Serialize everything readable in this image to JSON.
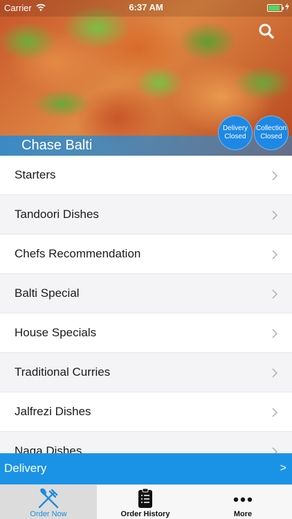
{
  "status_bar": {
    "carrier": "Carrier",
    "time": "6:37 AM",
    "battery_level": 0.9
  },
  "hero": {
    "restaurant_name": "Chase Balti",
    "delivery_status": {
      "line1": "Delivery",
      "line2": "Closed"
    },
    "collection_status": {
      "line1": "Collection",
      "line2": "Closed"
    }
  },
  "menu": {
    "items": [
      {
        "label": "Starters"
      },
      {
        "label": "Tandoori Dishes"
      },
      {
        "label": "Chefs Recommendation"
      },
      {
        "label": "Balti Special"
      },
      {
        "label": "House Specials"
      },
      {
        "label": "Traditional Curries"
      },
      {
        "label": "Jalfrezi Dishes"
      },
      {
        "label": "Naga Dishes"
      }
    ]
  },
  "delivery_bar": {
    "label": "Delivery",
    "arrow": ">"
  },
  "tab_bar": {
    "tabs": [
      {
        "label": "Order Now",
        "icon": "fork-knife-icon",
        "selected": true
      },
      {
        "label": "Order History",
        "icon": "clipboard-icon",
        "selected": false
      },
      {
        "label": "More",
        "icon": "more-dots-icon",
        "selected": false
      }
    ]
  },
  "colors": {
    "accent": "#1a93e6",
    "tab_selected": "#1a8ce0"
  }
}
